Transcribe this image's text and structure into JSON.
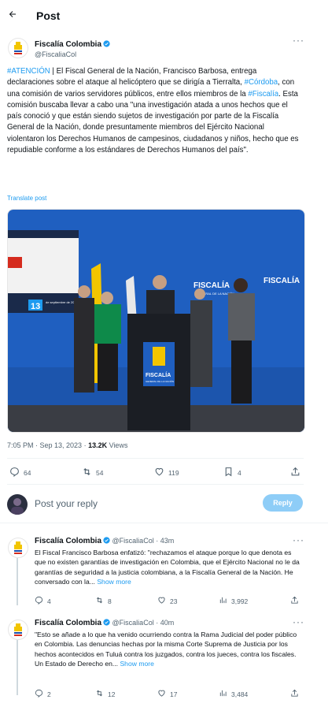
{
  "header": {
    "back_icon": "arrow-left-icon",
    "title": "Post"
  },
  "post": {
    "author_name": "Fiscalía Colombia",
    "author_handle": "@FiscaliaCol",
    "segments": [
      {
        "t": "#ATENCIÓN",
        "link": true
      },
      {
        "t": " | El Fiscal General de la Nación, Francisco Barbosa, entrega declaraciones sobre el ataque al helicóptero que se dirigía a Tierralta, ",
        "link": false
      },
      {
        "t": "#Córdoba",
        "link": true
      },
      {
        "t": ", con una comisión de varios servidores públicos, entre ellos miembros de la ",
        "link": false
      },
      {
        "t": "#Fiscalía",
        "link": true
      },
      {
        "t": ". Esta comisión buscaba llevar a cabo una \"una investigación atada a unos hechos que el país conoció y que están siendo sujetos de investigación por parte de la Fiscalía General de la Nación, donde presuntamente miembros del Ejército Nacional violentaron los Derechos Humanos de campesinos, ciudadanos y niños, hecho que es repudiable conforme a los estándares de Derechos Humanos del país\".",
        "link": false
      }
    ],
    "translate": "Translate post",
    "image": {
      "screen_date": "13",
      "screen_text": "de septiembre de 2023",
      "wall_brand": "FISCALÍA",
      "wall_sub": "GENERAL DE LA NACIÓN",
      "podium_brand": "FISCALÍA",
      "podium_sub": "GENERAL DE LA NACIÓN"
    },
    "time": "7:05 PM · Sep 13, 2023 · ",
    "views_count": "13.2K",
    "views_label": " Views",
    "actions": {
      "replies": "64",
      "reposts": "54",
      "likes": "119",
      "bookmarks": "4"
    }
  },
  "reply_box": {
    "placeholder": "Post your reply",
    "button": "Reply"
  },
  "replies": [
    {
      "name": "Fiscalía Colombia",
      "handle": "@FiscaliaCol",
      "time": "· 43m",
      "text": "El Fiscal Francisco Barbosa enfatizó: \"rechazamos el ataque porque lo que denota es que no existen garantías de investigación en Colombia, que el Ejército Nacional no le da garantías de seguridad a la justicia colombiana, a la Fiscalía General de la Nación. He conversado con la... ",
      "show_more": "Show more",
      "replies": "4",
      "reposts": "8",
      "likes": "23",
      "views": "3,992"
    },
    {
      "name": "Fiscalía Colombia",
      "handle": "@FiscaliaCol",
      "time": "· 40m",
      "text": "\"Esto se añade a lo que ha venido ocurriendo contra la Rama Judicial del poder público en Colombia. Las denuncias hechas por la misma Corte Suprema de Justicia por los hechos acontecidos en Tuluá contra los juzgados, contra los jueces, contra los fiscales. Un Estado de Derecho en... ",
      "show_more": "Show more",
      "replies": "2",
      "reposts": "12",
      "likes": "17",
      "views": "3,484"
    }
  ],
  "colors": {
    "accent": "#1d9bf0",
    "reply_button": "#8ecdf7",
    "wall": "#1f5fc0"
  }
}
